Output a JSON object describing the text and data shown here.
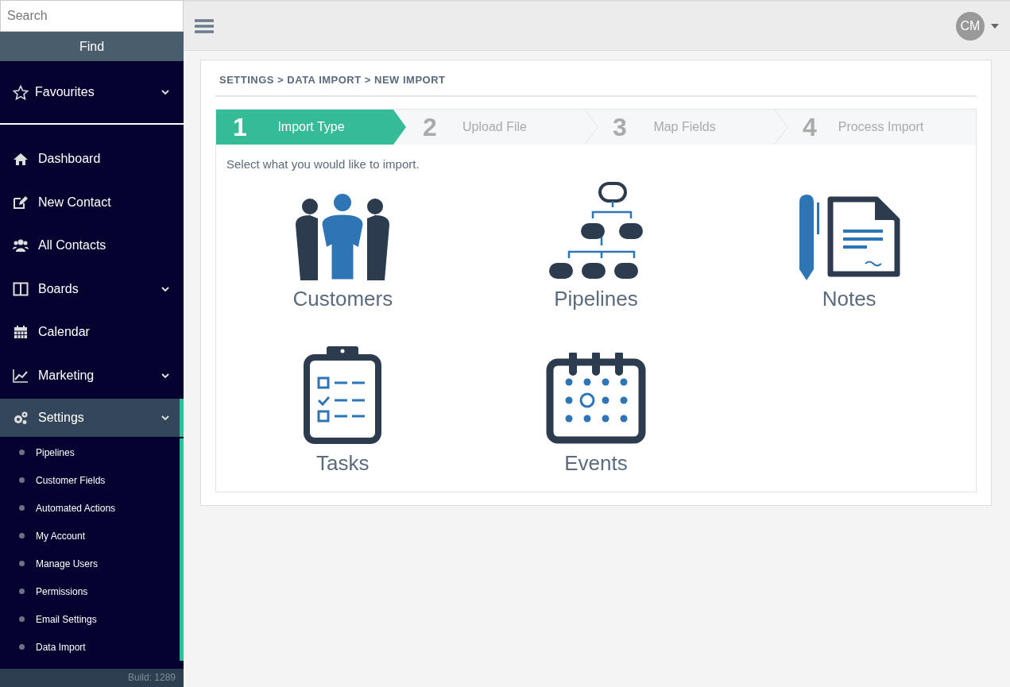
{
  "sidebar": {
    "search": {
      "placeholder": "Search"
    },
    "find_button": "Find",
    "favourites": {
      "label": "Favourites",
      "expanded": false
    },
    "items": [
      {
        "label": "Dashboard",
        "kind": "link",
        "selected": false
      },
      {
        "label": "New Contact",
        "kind": "link",
        "selected": false
      },
      {
        "label": "All Contacts",
        "kind": "link",
        "selected": false
      },
      {
        "label": "Boards",
        "kind": "group",
        "selected": false
      },
      {
        "label": "Calendar",
        "kind": "link",
        "selected": false
      },
      {
        "label": "Marketing",
        "kind": "group",
        "selected": false
      },
      {
        "label": "Settings",
        "kind": "group",
        "selected": true,
        "children": [
          {
            "label": "Pipelines"
          },
          {
            "label": "Customer Fields"
          },
          {
            "label": "Automated Actions"
          },
          {
            "label": "My Account"
          },
          {
            "label": "Manage Users"
          },
          {
            "label": "Permissions"
          },
          {
            "label": "Email Settings"
          },
          {
            "label": "Data Import"
          }
        ]
      }
    ],
    "build": "Build: 1289"
  },
  "topbar": {
    "avatar": "CM"
  },
  "breadcrumb": "SETTINGS > DATA IMPORT > NEW IMPORT",
  "steps": [
    {
      "number": "1",
      "label": "Import Type",
      "selected": true
    },
    {
      "number": "2",
      "label": "Upload File",
      "selected": false
    },
    {
      "number": "3",
      "label": "Map Fields",
      "selected": false
    },
    {
      "number": "4",
      "label": "Process Import",
      "selected": false
    }
  ],
  "prompt": "Select what you would like to import.",
  "import_types": [
    {
      "label": "Customers",
      "kind": "people"
    },
    {
      "label": "Pipelines",
      "kind": "hierarchy"
    },
    {
      "label": "Notes",
      "kind": "document"
    },
    {
      "label": "Tasks",
      "kind": "checklist"
    },
    {
      "label": "Events",
      "kind": "calendar"
    }
  ]
}
